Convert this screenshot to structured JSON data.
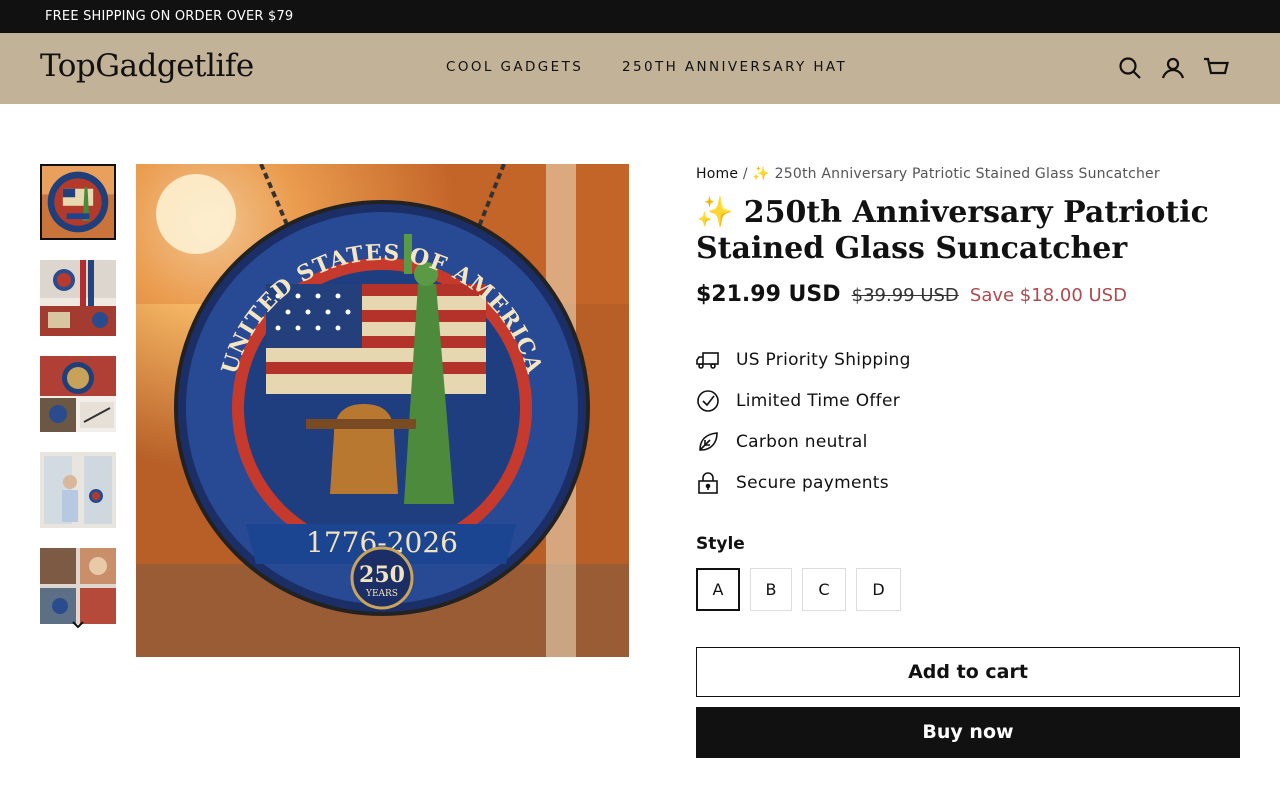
{
  "announcement": "FREE SHIPPING ON ORDER OVER $79",
  "header": {
    "logo": "TopGadgetlife",
    "nav": [
      "COOL GADGETS",
      "250TH ANNIVERSARY HAT"
    ],
    "icons": [
      "search-icon",
      "account-icon",
      "cart-icon"
    ],
    "background": "#c2b297"
  },
  "gallery": {
    "thumbnail_count": 5,
    "active_thumbnail": 1
  },
  "product": {
    "breadcrumb_home": "Home",
    "breadcrumb_separator": "/",
    "breadcrumb_current": "✨ 250th Anniversary Patriotic Stained Glass Suncatcher",
    "title": "✨ 250th Anniversary Patriotic Stained Glass Suncatcher",
    "price": "$21.99 USD",
    "compare_price": "$39.99 USD",
    "savings": "Save $18.00 USD",
    "features": [
      {
        "label": "US Priority Shipping",
        "icon": "truck-icon"
      },
      {
        "label": "Limited Time Offer",
        "icon": "check-circle-icon"
      },
      {
        "label": "Carbon neutral",
        "icon": "leaf-icon"
      },
      {
        "label": "Secure payments",
        "icon": "lock-icon"
      }
    ],
    "style_label": "Style",
    "styles": [
      "A",
      "B",
      "C",
      "D"
    ],
    "selected_style": "A",
    "add_to_cart": "Add to cart",
    "buy_now": "Buy now"
  },
  "image_text": {
    "ring": "UNITED STATES OF AMERICA",
    "years": "1776-2026",
    "count": "250",
    "count_sub": "YEARS"
  },
  "colors": {
    "sale": "#b04a4e",
    "dark": "#111111"
  }
}
